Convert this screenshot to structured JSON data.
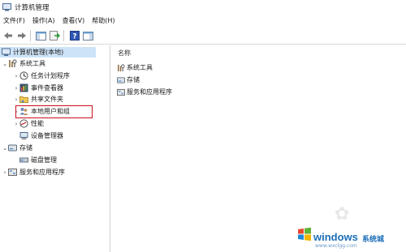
{
  "window": {
    "title": "计算机管理"
  },
  "menu": [
    "文件(F)",
    "操作(A)",
    "查看(V)",
    "帮助(H)"
  ],
  "toolbar": {
    "icons": [
      "back-arrow-icon",
      "forward-arrow-icon",
      "show-hide-tree-icon",
      "export-list-icon",
      "help-icon",
      "show-pane-icon"
    ]
  },
  "tree": {
    "root": "计算机管理(本地)",
    "system_tools": "系统工具",
    "task_scheduler": "任务计划程序",
    "event_viewer": "事件查看器",
    "shared_folders": "共享文件夹",
    "local_users_groups": "本地用户和组",
    "performance": "性能",
    "device_manager": "设备管理器",
    "storage": "存储",
    "disk_management": "磁盘管理",
    "services_apps": "服务和应用程序"
  },
  "right_pane": {
    "column_name": "名称",
    "items": [
      "系统工具",
      "存储",
      "服务和应用程序"
    ]
  },
  "watermark": {
    "brand": "windows",
    "cn": "系统城",
    "url": "www.wxclgg.com"
  }
}
